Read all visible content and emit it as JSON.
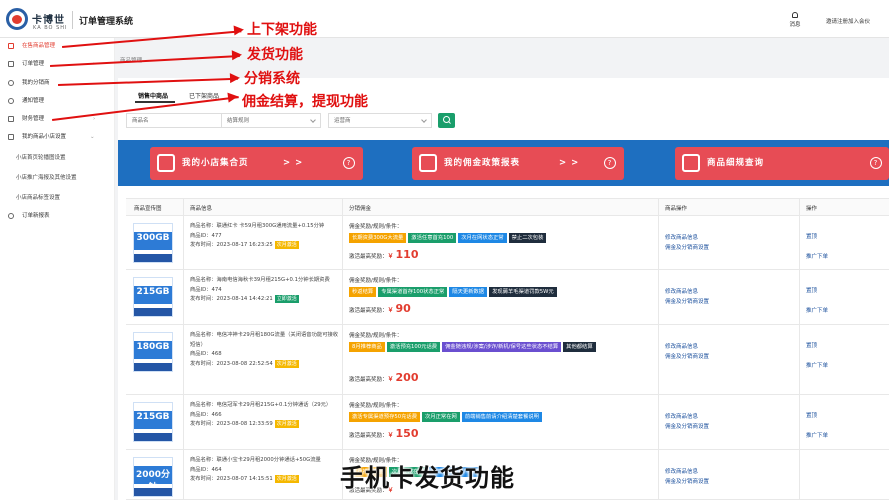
{
  "header": {
    "logo_cn": "卡博世",
    "logo_en": "KA BO SHI",
    "app_title": "订单管理系统",
    "messages_label": "消息",
    "user_label": "邀请注册加入会伙"
  },
  "sidebar": {
    "items": [
      {
        "label": "在售商品管理",
        "active": true
      },
      {
        "label": "订单管理"
      },
      {
        "label": "我的分销商"
      },
      {
        "label": "通知管理"
      },
      {
        "label": "财务管理"
      },
      {
        "label": "我的商品小店设置"
      }
    ],
    "sub_items": [
      "小店首页轮播图设置",
      "小店推广海报及其他设置",
      "小店商品标签设置"
    ],
    "last_item": "订单新报表"
  },
  "breadcrumb": "商品管理",
  "tabs": [
    "销售中商品",
    "已下架商品"
  ],
  "filters": {
    "name_placeholder": "商品名",
    "package_placeholder": "结算规则",
    "carrier_placeholder": "运营商"
  },
  "banner": {
    "buttons": [
      {
        "label": "我的小店集合页",
        "arrow": "> >",
        "help": "?"
      },
      {
        "label": "我的佣金政策报表",
        "arrow": "> >",
        "help": "?"
      },
      {
        "label": "商品细规查询",
        "arrow": "> >",
        "help": "?"
      }
    ]
  },
  "table": {
    "headers": [
      "商品宣传图",
      "商品信息",
      "分销佣金",
      "商品操作",
      "操作"
    ],
    "commission_title": "佣金奖励/规则/条件：",
    "max_reward_label": "激活最高奖励：",
    "currency": "￥",
    "rows": [
      {
        "thumb": "300GB",
        "name_line": "商品名称：联通红卡 卡59月租300G通用流量+0.15分钟",
        "id": "商品ID：477",
        "date": "发布时间：2023-08-17 16:23:25",
        "badge": "次月激活",
        "tags": [
          [
            "长期资费300G大流量",
            "y"
          ],
          [
            "激活任意首充100",
            "g"
          ],
          [
            "次月在网状态正常",
            "b"
          ],
          [
            "禁止二次包装",
            "d"
          ]
        ],
        "price": "110",
        "op1": "修改商品信息",
        "op2": "佣金及分销商设置",
        "act1": "置顶",
        "act2": "推广下单"
      },
      {
        "thumb": "215GB",
        "name_line": "商品名称：海南电信海秋卡39月租215G+0.1分钟长期资费",
        "id": "商品ID：474",
        "date": "发布时间：2023-08-14 14:42:21",
        "badge": "立即激活",
        "tags": [
          [
            "秒返结算",
            "y"
          ],
          [
            "专属渠道首存100状态正常",
            "g"
          ],
          [
            "隔天更新数据",
            "b"
          ],
          [
            "发现薅羊毛渠道罚款5W元",
            "d"
          ]
        ],
        "price": "90",
        "op1": "修改商品信息",
        "op2": "佣金及分销商设置",
        "act1": "置顶",
        "act2": "推广下单"
      },
      {
        "thumb": "180GB",
        "name_line": "商品名称：电信冲神卡29月租180G流量（关闭语音功能可接收短信）",
        "id": "商品ID：468",
        "date": "发布时间：2023-08-08 22:52:54",
        "badge": "次月激活",
        "tags": [
          [
            "8月推荐商品",
            "y"
          ],
          [
            "激活预充100元话费",
            "g"
          ],
          [
            "佣金随违规/涉案/涉诈/新机/保号这些状态不结算",
            "p"
          ],
          [
            "其他都结算",
            "d"
          ]
        ],
        "price": "200",
        "op1": "修改商品信息",
        "op2": "佣金及分销商设置",
        "act1": "置顶",
        "act2": "推广下单"
      },
      {
        "thumb": "215GB",
        "name_line": "商品名称：电信冠军卡29月租215G+0.1分钟通话（29元）",
        "id": "商品ID：466",
        "date": "发布时间：2023-08-08 12:33:59",
        "badge": "次月激活",
        "tags": [
          [
            "激活专属渠道预存50充话费",
            "y"
          ],
          [
            "次月正常在网",
            "g"
          ],
          [
            "前端销售前请介绍清楚套餐说明",
            "b"
          ]
        ],
        "price": "150",
        "op1": "修改商品信息",
        "op2": "佣金及分销商设置",
        "act1": "置顶",
        "act2": "推广下单"
      },
      {
        "thumb": "2000分钟",
        "name_line": "商品名称：联通小宝卡29月租2000分钟通话+50G流量",
        "id": "商品ID：464",
        "date": "发布时间：2023-08-07 14:15:51",
        "badge": "次月激活",
        "tags": [
          [
            "推荐推广商品",
            "y"
          ],
          [
            "次月正常在网",
            "g"
          ],
          [
            "前端请做好推广订单",
            "b"
          ]
        ],
        "price": "",
        "op1": "修改商品信息",
        "op2": "佣金及分销商设置",
        "act1": "",
        "act2": ""
      }
    ]
  },
  "annotations": [
    "上下架功能",
    "发货功能",
    "分销系统",
    "佣金结算，提现功能"
  ],
  "caption": "手机卡发货功能"
}
